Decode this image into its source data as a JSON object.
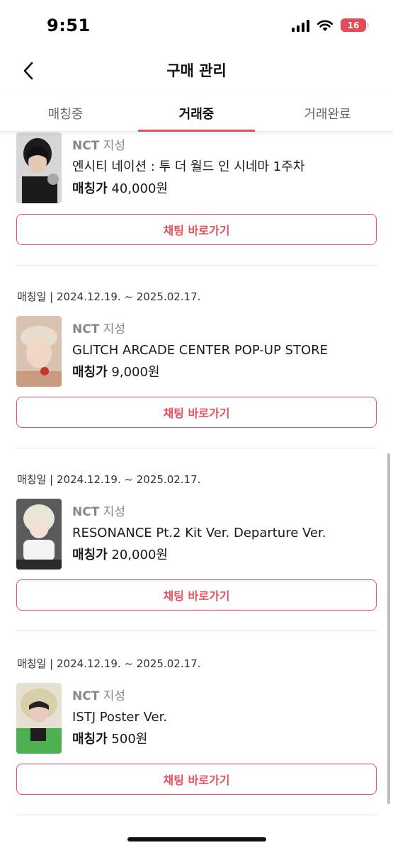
{
  "status_bar": {
    "time": "9:51",
    "battery": "16",
    "icons": [
      "signal-icon",
      "wifi-icon",
      "battery-icon"
    ]
  },
  "header": {
    "title": "구매 관리",
    "back_icon": "chevron-left-icon"
  },
  "tabs": [
    {
      "label": "매칭중",
      "active": false
    },
    {
      "label": "거래중",
      "active": true
    },
    {
      "label": "거래완료",
      "active": false
    }
  ],
  "items": [
    {
      "match_date": "",
      "artist": "NCT",
      "member": "지성",
      "title": "엔시티 네이션 : 투 더 월드 인 시네마 1주차",
      "price_label": "매칭가",
      "price": "40,000원",
      "chat_button": "채팅 바로가기"
    },
    {
      "match_date": "매칭일 | 2024.12.19. ~ 2025.02.17.",
      "artist": "NCT",
      "member": "지성",
      "title": "GLITCH ARCADE CENTER POP-UP STORE",
      "price_label": "매칭가",
      "price": "9,000원",
      "chat_button": "채팅 바로가기"
    },
    {
      "match_date": "매칭일 | 2024.12.19. ~ 2025.02.17.",
      "artist": "NCT",
      "member": "지성",
      "title": "RESONANCE Pt.2 Kit Ver. Departure Ver.",
      "price_label": "매칭가",
      "price": "20,000원",
      "chat_button": "채팅 바로가기"
    },
    {
      "match_date": "매칭일 | 2024.12.19. ~ 2025.02.17.",
      "artist": "NCT",
      "member": "지성",
      "title": "ISTJ Poster Ver.",
      "price_label": "매칭가",
      "price": "500원",
      "chat_button": "채팅 바로가기"
    }
  ],
  "colors": {
    "accent": "#e8505b",
    "battery": "#e8495a",
    "muted_text": "#888888"
  }
}
